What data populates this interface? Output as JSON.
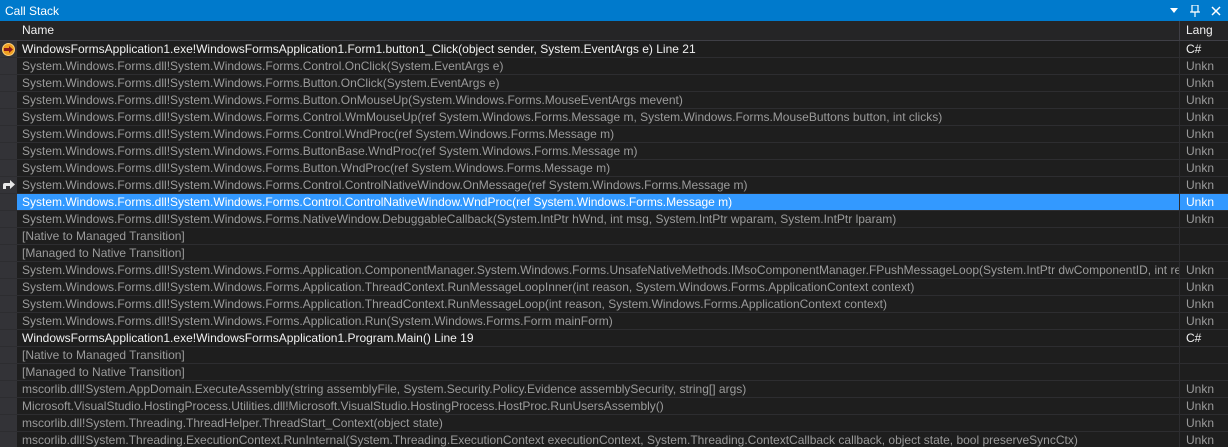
{
  "window": {
    "title": "Call Stack"
  },
  "columns": {
    "name": "Name",
    "language": "Lang"
  },
  "rows": [
    {
      "name": "WindowsFormsApplication1.exe!WindowsFormsApplication1.Form1.button1_Click(object sender, System.EventArgs e) Line 21",
      "language": "C#",
      "kind": "user",
      "marker": "current"
    },
    {
      "name": "System.Windows.Forms.dll!System.Windows.Forms.Control.OnClick(System.EventArgs e)",
      "language": "Unkn",
      "kind": "external",
      "marker": ""
    },
    {
      "name": "System.Windows.Forms.dll!System.Windows.Forms.Button.OnClick(System.EventArgs e)",
      "language": "Unkn",
      "kind": "external",
      "marker": ""
    },
    {
      "name": "System.Windows.Forms.dll!System.Windows.Forms.Button.OnMouseUp(System.Windows.Forms.MouseEventArgs mevent)",
      "language": "Unkn",
      "kind": "external",
      "marker": ""
    },
    {
      "name": "System.Windows.Forms.dll!System.Windows.Forms.Control.WmMouseUp(ref System.Windows.Forms.Message m, System.Windows.Forms.MouseButtons button, int clicks)",
      "language": "Unkn",
      "kind": "external",
      "marker": ""
    },
    {
      "name": "System.Windows.Forms.dll!System.Windows.Forms.Control.WndProc(ref System.Windows.Forms.Message m)",
      "language": "Unkn",
      "kind": "external",
      "marker": ""
    },
    {
      "name": "System.Windows.Forms.dll!System.Windows.Forms.ButtonBase.WndProc(ref System.Windows.Forms.Message m)",
      "language": "Unkn",
      "kind": "external",
      "marker": ""
    },
    {
      "name": "System.Windows.Forms.dll!System.Windows.Forms.Button.WndProc(ref System.Windows.Forms.Message m)",
      "language": "Unkn",
      "kind": "external",
      "marker": ""
    },
    {
      "name": "System.Windows.Forms.dll!System.Windows.Forms.Control.ControlNativeWindow.OnMessage(ref System.Windows.Forms.Message m)",
      "language": "Unkn",
      "kind": "external",
      "marker": "callsite"
    },
    {
      "name": "System.Windows.Forms.dll!System.Windows.Forms.Control.ControlNativeWindow.WndProc(ref System.Windows.Forms.Message m)",
      "language": "Unkn",
      "kind": "external",
      "marker": "",
      "selected": true
    },
    {
      "name": "System.Windows.Forms.dll!System.Windows.Forms.NativeWindow.DebuggableCallback(System.IntPtr hWnd, int msg, System.IntPtr wparam, System.IntPtr lparam)",
      "language": "Unkn",
      "kind": "external",
      "marker": ""
    },
    {
      "name": "[Native to Managed Transition]",
      "language": "",
      "kind": "external",
      "marker": ""
    },
    {
      "name": "[Managed to Native Transition]",
      "language": "",
      "kind": "external",
      "marker": ""
    },
    {
      "name": "System.Windows.Forms.dll!System.Windows.Forms.Application.ComponentManager.System.Windows.Forms.UnsafeNativeMethods.IMsoComponentManager.FPushMessageLoop(System.IntPtr dwComponentID, int reas",
      "language": "Unkn",
      "kind": "external",
      "marker": ""
    },
    {
      "name": "System.Windows.Forms.dll!System.Windows.Forms.Application.ThreadContext.RunMessageLoopInner(int reason, System.Windows.Forms.ApplicationContext context)",
      "language": "Unkn",
      "kind": "external",
      "marker": ""
    },
    {
      "name": "System.Windows.Forms.dll!System.Windows.Forms.Application.ThreadContext.RunMessageLoop(int reason, System.Windows.Forms.ApplicationContext context)",
      "language": "Unkn",
      "kind": "external",
      "marker": ""
    },
    {
      "name": "System.Windows.Forms.dll!System.Windows.Forms.Application.Run(System.Windows.Forms.Form mainForm)",
      "language": "Unkn",
      "kind": "external",
      "marker": ""
    },
    {
      "name": "WindowsFormsApplication1.exe!WindowsFormsApplication1.Program.Main() Line 19",
      "language": "C#",
      "kind": "user",
      "marker": ""
    },
    {
      "name": "[Native to Managed Transition]",
      "language": "",
      "kind": "external",
      "marker": ""
    },
    {
      "name": "[Managed to Native Transition]",
      "language": "",
      "kind": "external",
      "marker": ""
    },
    {
      "name": "mscorlib.dll!System.AppDomain.ExecuteAssembly(string assemblyFile, System.Security.Policy.Evidence assemblySecurity, string[] args)",
      "language": "Unkn",
      "kind": "external",
      "marker": ""
    },
    {
      "name": "Microsoft.VisualStudio.HostingProcess.Utilities.dll!Microsoft.VisualStudio.HostingProcess.HostProc.RunUsersAssembly()",
      "language": "Unkn",
      "kind": "external",
      "marker": ""
    },
    {
      "name": "mscorlib.dll!System.Threading.ThreadHelper.ThreadStart_Context(object state)",
      "language": "Unkn",
      "kind": "external",
      "marker": ""
    },
    {
      "name": "mscorlib.dll!System.Threading.ExecutionContext.RunInternal(System.Threading.ExecutionContext executionContext, System.Threading.ContextCallback callback, object state, bool preserveSyncCtx)",
      "language": "Unkn",
      "kind": "external",
      "marker": ""
    }
  ],
  "icons": {
    "current": "current-statement-icon",
    "callsite": "call-return-arrow-icon",
    "dropdown": "dropdown-arrow-icon",
    "pin": "pin-icon",
    "close": "close-icon"
  },
  "colors": {
    "accent": "#007acc",
    "selection": "#3399ff",
    "current_marker": "#f0a020"
  }
}
